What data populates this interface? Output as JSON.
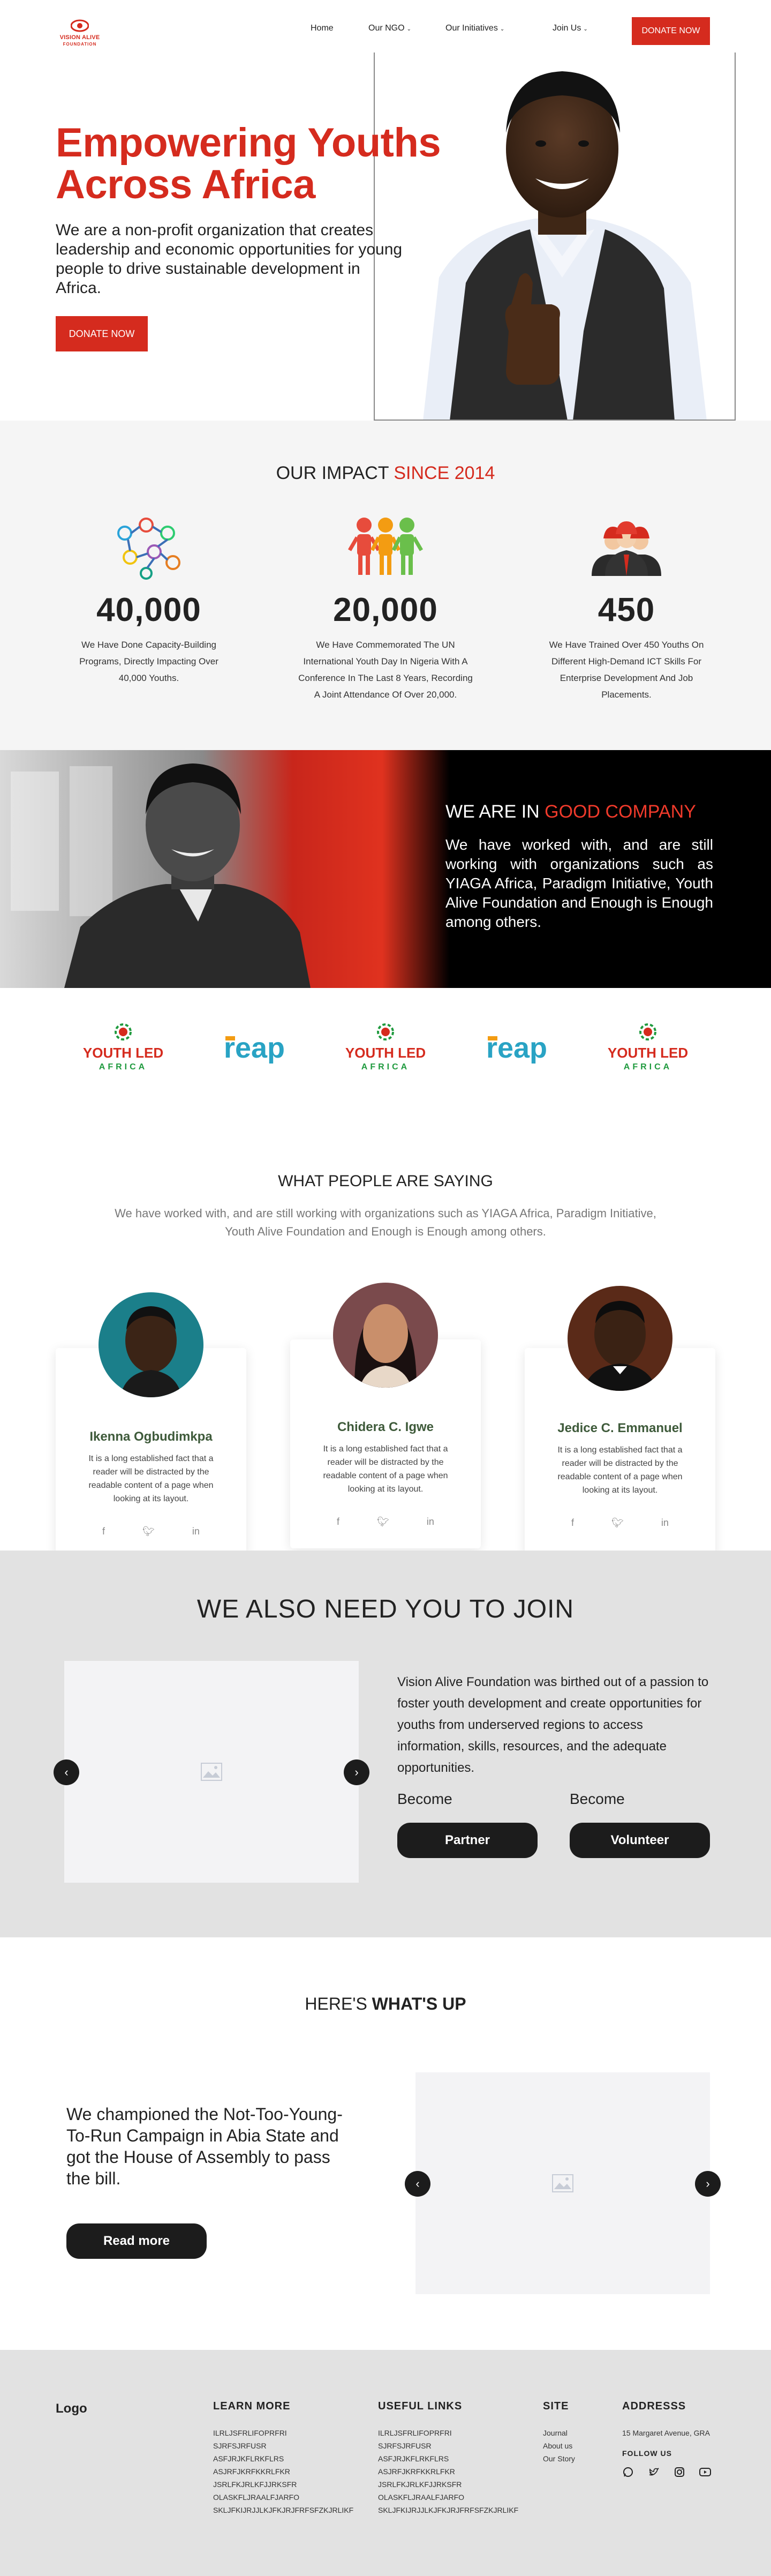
{
  "header": {
    "logo_text": "VISION ALIVE",
    "logo_sub": "FOUNDATION",
    "nav": [
      "Home",
      "Our NGO",
      "Our Initiatives",
      "Join Us"
    ],
    "donate_label": "DONATE NOW"
  },
  "hero": {
    "title_line1": "Empowering Youths",
    "title_line2": "Across Africa",
    "subtitle": "We are a non-profit organization that creates leadership and economic opportunities for young people to drive sustainable development in Africa.",
    "donate_label": "DONATE NOW"
  },
  "impact": {
    "title": "OUR IMPACT ",
    "title_accent": "SINCE 2014",
    "items": [
      {
        "number": "40,000",
        "text": "We Have Done Capacity-Building Programs, Directly Impacting Over 40,000 Youths."
      },
      {
        "number": "20,000",
        "text": "We Have Commemorated The UN International Youth Day In Nigeria With A Conference In The Last 8 Years, Recording A Joint Attendance Of Over 20,000."
      },
      {
        "number": "450",
        "text": "We Have Trained Over 450 Youths On Different High-Demand ICT Skills For Enterprise Development And Job Placements."
      }
    ]
  },
  "company": {
    "title": "WE ARE IN ",
    "title_accent": "GOOD COMPANY",
    "body": "We have worked with, and are still working with organizations such as YIAGA Africa, Paradigm Initiative, Youth Alive Foundation and Enough is Enough among others."
  },
  "partners": [
    {
      "line1": "YOUTH LED",
      "line2": "AFRICA"
    },
    {
      "line1": "reap"
    },
    {
      "line1": "YOUTH LED",
      "line2": "AFRICA"
    },
    {
      "line1": "reap"
    },
    {
      "line1": "YOUTH LED",
      "line2": "AFRICA"
    }
  ],
  "testimonials": {
    "title": "WHAT PEOPLE ARE SAYING",
    "subtitle": "We have worked with, and are still working with organizations such as YIAGA Africa, Paradigm Initiative, Youth Alive Foundation and Enough is Enough among others.",
    "cards": [
      {
        "name": "Ikenna Ogbudimkpa",
        "text": "It is a long established fact that a reader will be distracted by the readable content of a page when looking at its layout."
      },
      {
        "name": "Chidera C. Igwe",
        "text": "It is a long established fact that a reader will be distracted by the readable content of a page when looking at its layout."
      },
      {
        "name": "Jedice C. Emmanuel",
        "text": "It is a long established fact that a reader will be distracted by the readable content of a page when looking at its layout."
      }
    ]
  },
  "join": {
    "title": "WE ALSO NEED YOU TO JOIN",
    "text": "Vision Alive Foundation was birthed out of a passion to foster youth development and create opportunities for youths from underserved regions to access information, skills, resources, and the adequate opportunities.",
    "become1": "Become",
    "partner_label": "Partner",
    "become2": "Become",
    "volunteer_label": "Volunteer"
  },
  "whatsup": {
    "title_light": "HERE'S ",
    "title_bold": "WHAT'S UP",
    "text": "We championed the Not-Too-Young-To-Run Campaign in Abia State and got the House of Assembly to pass the bill.",
    "read_more_label": "Read more"
  },
  "footer": {
    "logo": "Logo",
    "learn_more": {
      "title": "LEARN MORE",
      "items": [
        "ILRLJSFRLIFOPRFRI",
        "SJRFSJRFUSR",
        "ASFJRJKFLRKFLRS",
        "ASJRFJKRFKKRLFKR",
        "JSRLFKJRLKFJJRKSFR",
        "OLASKFLJRAALFJARFO",
        "SKLJFKIJRJJLKJFKJRJFRFSFZKJRLIKF"
      ]
    },
    "useful_links": {
      "title": "USEFUL LINKS",
      "items": [
        "ILRLJSFRLIFOPRFRI",
        "SJRFSJRFUSR",
        "ASFJRJKFLRKFLRS",
        "ASJRFJKRFKKRLFKR",
        "JSRLFKJRLKFJJRKSFR",
        "OLASKFLJRAALFJARFO",
        "SKLJFKIJRJJLKJFKJRJFRFSFZKJRLIKF"
      ]
    },
    "site": {
      "title": "SITE",
      "items": [
        "Journal",
        "About us",
        "Our Story"
      ]
    },
    "address": {
      "title": "ADDRESSS",
      "line": "15 Margaret Avenue, GRA",
      "follow": "FOLLOW US",
      "icons": [
        "whatsapp-icon",
        "twitter-icon",
        "instagram-icon",
        "youtube-icon"
      ]
    }
  },
  "colors": {
    "brand_red": "#d52b1e",
    "dark": "#1c1c1c",
    "light_gray": "#e2e2e2"
  }
}
